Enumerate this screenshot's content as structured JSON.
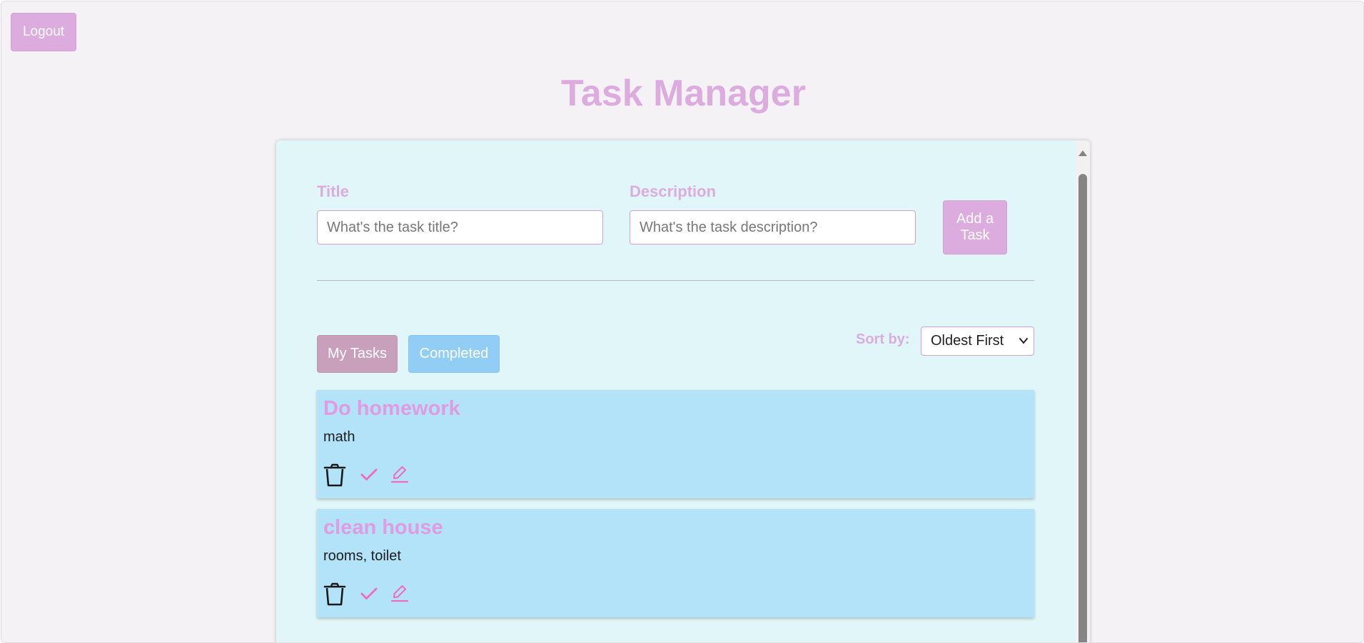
{
  "header": {
    "logout_label": "Logout",
    "app_title": "Task Manager"
  },
  "form": {
    "title_label": "Title",
    "title_placeholder": "What's the task title?",
    "title_value": "",
    "description_label": "Description",
    "description_placeholder": "What's the task description?",
    "description_value": "",
    "add_button_label": "Add a Task"
  },
  "tabs": [
    {
      "label": "My Tasks",
      "active": true,
      "color": "#c8a0bb"
    },
    {
      "label": "Completed",
      "active": false,
      "color": "#92cdf6"
    }
  ],
  "sort": {
    "label": "Sort by:",
    "selected": "Oldest First"
  },
  "tasks": [
    {
      "title": "Do homework",
      "description": "math",
      "actions": [
        "trash-icon",
        "check-icon",
        "pencil-icon"
      ]
    },
    {
      "title": "clean house",
      "description": "rooms, toilet",
      "actions": [
        "trash-icon",
        "check-icon",
        "pencil-icon"
      ]
    }
  ],
  "colors": {
    "accent": "#dcacdf",
    "task_title": "#e19be2",
    "panel_bg": "#e0f6f8",
    "card_bg": "#b2e3f9",
    "action_pink": "#f06bbf"
  }
}
